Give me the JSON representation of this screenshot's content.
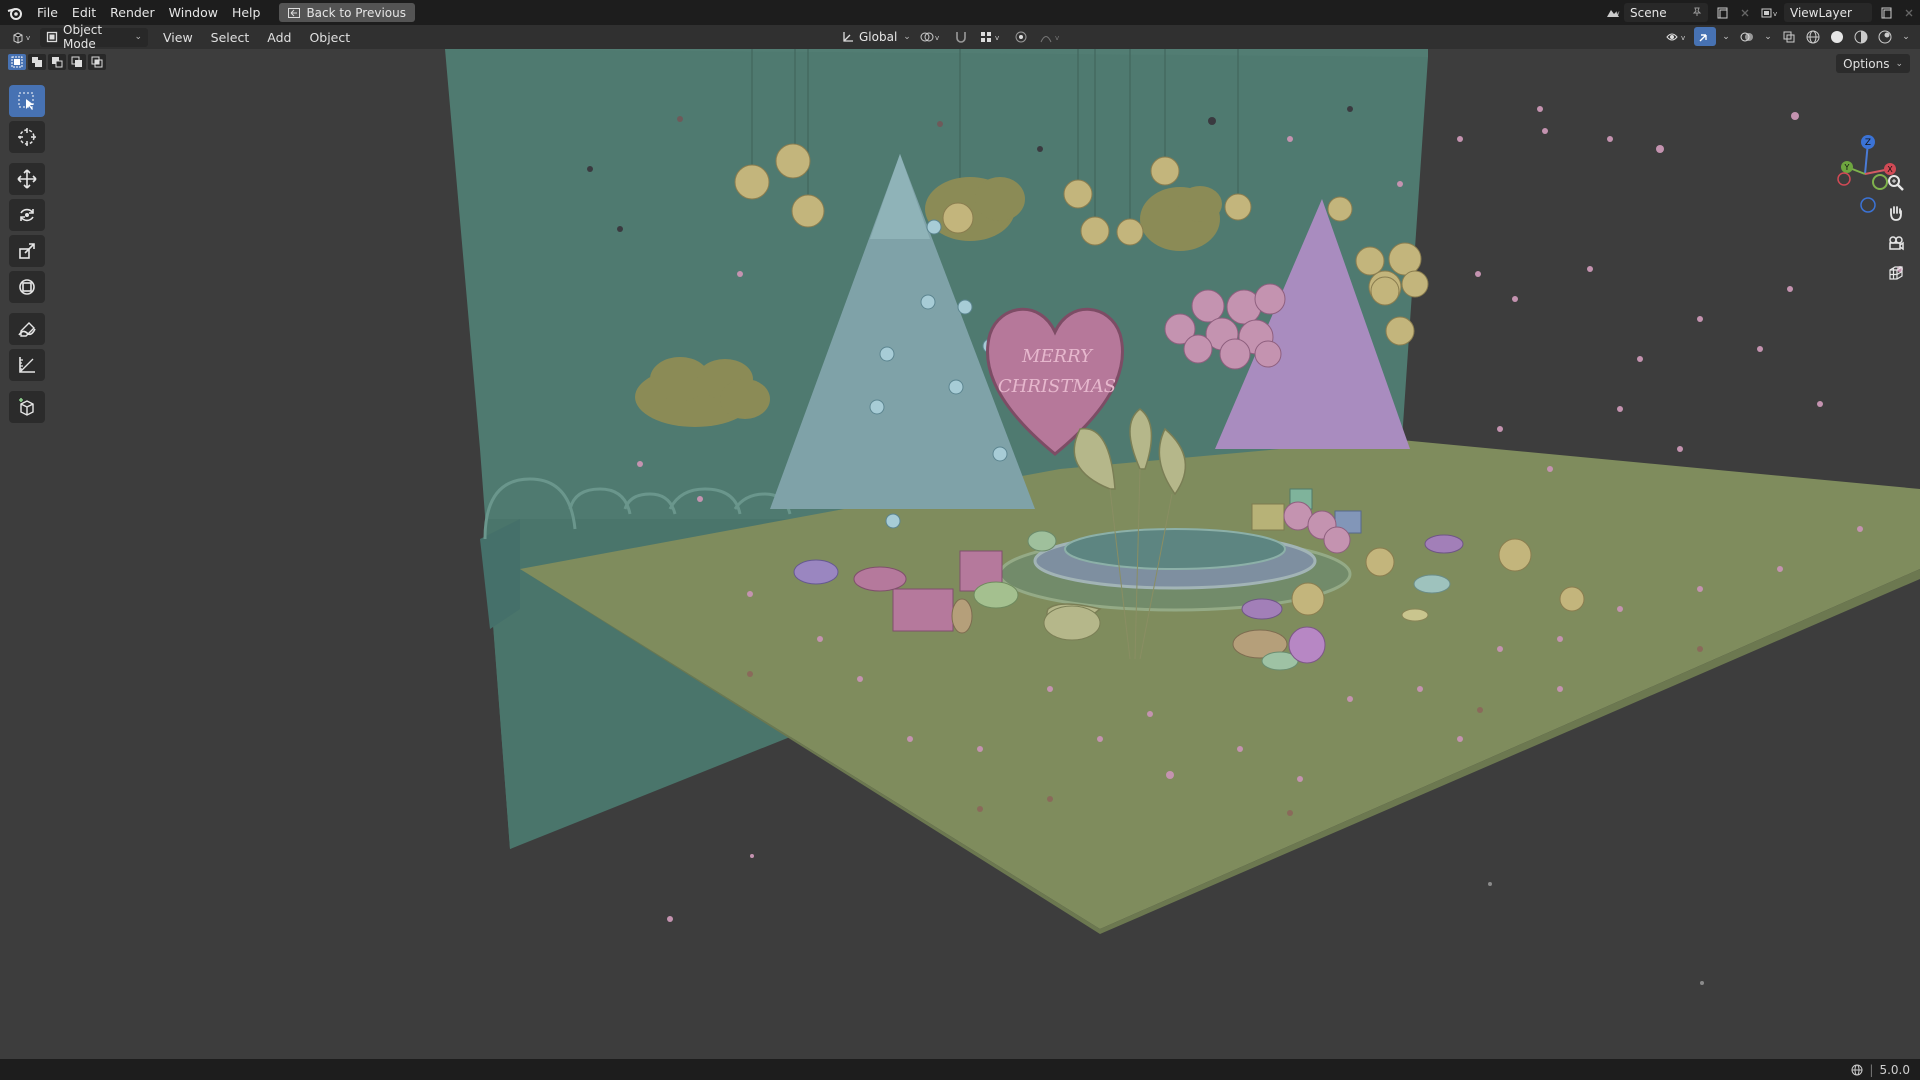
{
  "menu": {
    "file": "File",
    "edit": "Edit",
    "render": "Render",
    "window": "Window",
    "help": "Help",
    "back_to_previous": "Back to Previous"
  },
  "topbar_right": {
    "scene_name": "Scene",
    "view_layer": "ViewLayer"
  },
  "header": {
    "mode": "Object Mode",
    "view": "View",
    "select": "Select",
    "add": "Add",
    "object": "Object",
    "transform_orientation": "Global"
  },
  "viewport": {
    "options_label": "Options",
    "heart_text_line1": "MERRY",
    "heart_text_line2": "CHRISTMAS",
    "gizmo_axes": [
      "Z",
      "Y",
      "X"
    ]
  },
  "statusbar": {
    "version": "5.0.0"
  },
  "colors": {
    "wall": "#4f7a70",
    "floor": "#7f8c5d",
    "tree_left": "#7fa2a8",
    "tree_right": "#a98cbf",
    "gold": "#c3b57c",
    "pink": "#c493b0",
    "accent": "#4772b3"
  }
}
